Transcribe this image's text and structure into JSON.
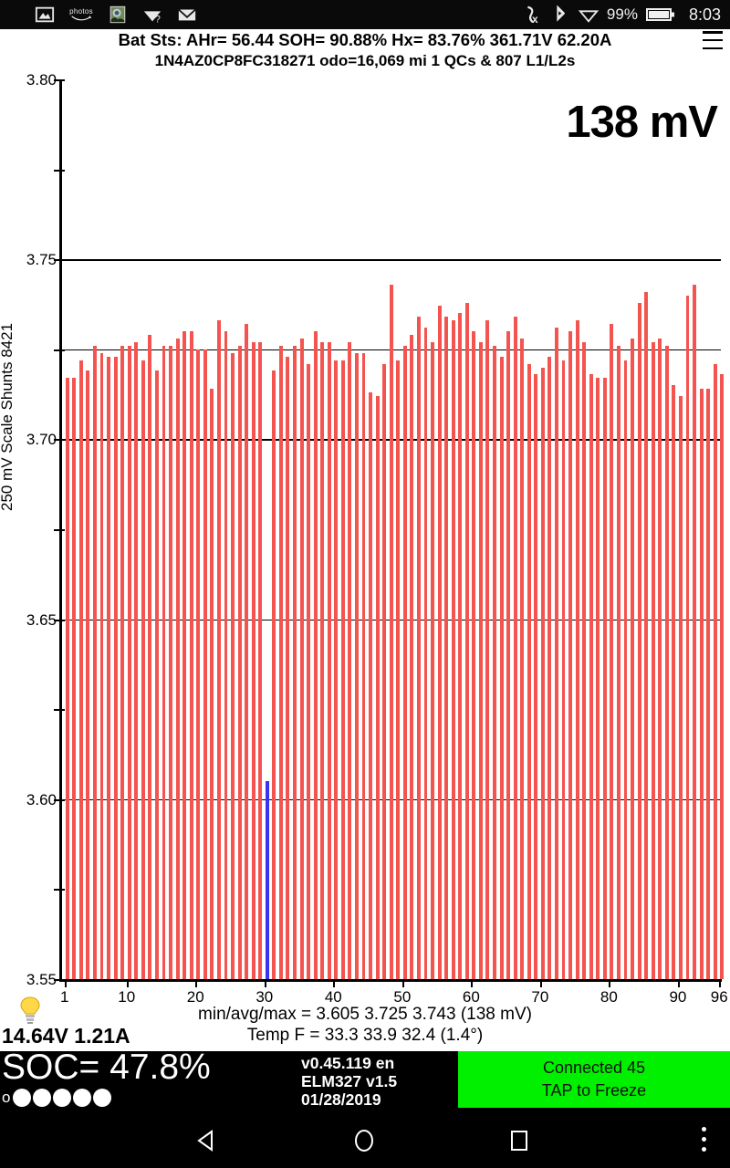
{
  "status_bar": {
    "left_icons": [
      "image-icon",
      "photos-icon",
      "app-icon",
      "wifi-question-icon",
      "mail-icon"
    ],
    "photos_label": "photos",
    "wifi_question": "?",
    "right_icons": [
      "mute-icon",
      "bluetooth-icon",
      "wifi-icon"
    ],
    "battery_percent": "99%",
    "clock": "8:03"
  },
  "header": {
    "line1": "Bat Sts:  AHr= 56.44  SOH= 90.88%   Hx= 83.76%   361.71V 62.20A",
    "line2": "1N4AZ0CP8FC318271 odo=16,069 mi  1 QCs & 807 L1/L2s",
    "menu_icon": "hamburger-menu-icon"
  },
  "chart_overlay": {
    "big_value": "138 mV"
  },
  "below_chart": {
    "bulb_icon": "lightbulb-icon",
    "aux_voltage": "14.64V 1.21A",
    "min_avg_max": "min/avg/max = 3.605 3.725 3.743  (138 mV)",
    "temp": "Temp F = 33.3  33.9  32.4  (1.4°)"
  },
  "footer": {
    "soc_label": "SOC= 47.8%",
    "soc_dots_zero": "o",
    "soc_dots_filled": 5,
    "version_lines": [
      "v0.45.119 en",
      "ELM327 v1.5",
      "01/28/2019"
    ],
    "connect_button": {
      "line1": "Connected 45",
      "line2": "TAP to Freeze",
      "color": "#00f000"
    }
  },
  "nav_bar": {
    "back_icon": "back-triangle-icon",
    "home_icon": "home-circle-icon",
    "recents_icon": "recents-square-icon",
    "overflow_icon": "overflow-dots-icon"
  },
  "colors": {
    "bar": "#f4544f",
    "bar_low": "#3a34f0",
    "accent_green": "#00f000",
    "axis": "#000000"
  },
  "chart_data": {
    "type": "bar",
    "title": "",
    "xlabel": "",
    "ylabel": "250 mV Scale  Shunts 8421",
    "ylim": [
      3.55,
      3.8
    ],
    "yticks": [
      3.55,
      3.6,
      3.65,
      3.7,
      3.75,
      3.8
    ],
    "yminor": [
      3.575,
      3.625,
      3.675,
      3.725,
      3.775
    ],
    "grid": true,
    "gridlines_major": [
      3.6,
      3.65,
      3.7,
      3.75,
      3.725
    ],
    "legend": null,
    "xticks": [
      1,
      10,
      20,
      30,
      40,
      50,
      60,
      70,
      80,
      90,
      96
    ],
    "xtick_labels": [
      "1",
      "10",
      "20",
      "30",
      "40",
      "50",
      "60",
      "70",
      "80",
      "90",
      "96"
    ],
    "x": [
      1,
      2,
      3,
      4,
      5,
      6,
      7,
      8,
      9,
      10,
      11,
      12,
      13,
      14,
      15,
      16,
      17,
      18,
      19,
      20,
      21,
      22,
      23,
      24,
      25,
      26,
      27,
      28,
      29,
      30,
      31,
      32,
      33,
      34,
      35,
      36,
      37,
      38,
      39,
      40,
      41,
      42,
      43,
      44,
      45,
      46,
      47,
      48,
      49,
      50,
      51,
      52,
      53,
      54,
      55,
      56,
      57,
      58,
      59,
      60,
      61,
      62,
      63,
      64,
      65,
      66,
      67,
      68,
      69,
      70,
      71,
      72,
      73,
      74,
      75,
      76,
      77,
      78,
      79,
      80,
      81,
      82,
      83,
      84,
      85,
      86,
      87,
      88,
      89,
      90,
      91,
      92,
      93,
      94,
      95,
      96
    ],
    "values": [
      3.717,
      3.717,
      3.722,
      3.719,
      3.726,
      3.724,
      3.723,
      3.723,
      3.726,
      3.726,
      3.727,
      3.722,
      3.729,
      3.719,
      3.726,
      3.726,
      3.728,
      3.73,
      3.73,
      3.725,
      3.725,
      3.714,
      3.733,
      3.73,
      3.724,
      3.726,
      3.732,
      3.727,
      3.727,
      3.605,
      3.719,
      3.726,
      3.723,
      3.726,
      3.728,
      3.721,
      3.73,
      3.727,
      3.727,
      3.722,
      3.722,
      3.727,
      3.724,
      3.724,
      3.713,
      3.712,
      3.721,
      3.743,
      3.722,
      3.726,
      3.729,
      3.734,
      3.731,
      3.727,
      3.737,
      3.734,
      3.733,
      3.735,
      3.738,
      3.73,
      3.727,
      3.733,
      3.726,
      3.723,
      3.73,
      3.734,
      3.728,
      3.721,
      3.718,
      3.72,
      3.723,
      3.731,
      3.722,
      3.73,
      3.733,
      3.727,
      3.718,
      3.717,
      3.717,
      3.732,
      3.726,
      3.722,
      3.728,
      3.738,
      3.741,
      3.727,
      3.728,
      3.726,
      3.715,
      3.712,
      3.74,
      3.743,
      3.714,
      3.714,
      3.721,
      3.718
    ],
    "low_index": 30,
    "annotations": [
      {
        "text": "138 mV",
        "position": "top-right"
      },
      {
        "text": "min/avg/max = 3.605 3.725 3.743  (138 mV)",
        "position": "below-axis"
      },
      {
        "text": "Temp F = 33.3  33.9  32.4  (1.4°)",
        "position": "below-axis"
      }
    ]
  }
}
